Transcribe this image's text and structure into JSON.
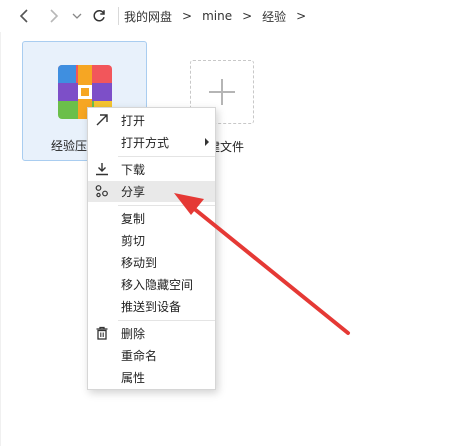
{
  "nav": {
    "breadcrumb": [
      "我的网盘",
      "mine",
      "经验"
    ],
    "separator": ">"
  },
  "file": {
    "name_visible": "经验压"
  },
  "new_file": {
    "label_visible": "建文件"
  },
  "context_menu": {
    "items": [
      {
        "label": "打开",
        "icon": "open-arrow-icon"
      },
      {
        "label": "打开方式",
        "submenu": true
      },
      {
        "label": "下载",
        "icon": "download-icon"
      },
      {
        "label": "分享",
        "icon": "share-icon",
        "highlighted": true
      },
      {
        "label": "复制"
      },
      {
        "label": "剪切"
      },
      {
        "label": "移动到"
      },
      {
        "label": "移入隐藏空间"
      },
      {
        "label": "推送到设备"
      },
      {
        "label": "删除",
        "icon": "trash-icon"
      },
      {
        "label": "重命名"
      },
      {
        "label": "属性"
      }
    ]
  },
  "colors": {
    "selection_bg": "#e8f1fb",
    "selection_border": "#a9cdf0",
    "annotation_arrow": "#e53935",
    "menu_hover": "#e9e9e9"
  }
}
